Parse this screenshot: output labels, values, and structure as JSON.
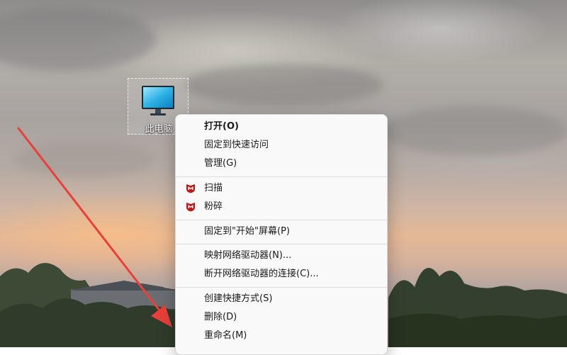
{
  "desktop": {
    "icon_label": "此电脑"
  },
  "context_menu": {
    "items": [
      {
        "label": "打开(O)",
        "bold": true
      },
      {
        "label": "固定到快速访问"
      },
      {
        "label": "管理(G)"
      },
      {
        "label": "扫描",
        "icon": "mcafee-shield-icon"
      },
      {
        "label": "粉碎",
        "icon": "mcafee-shield-icon"
      },
      {
        "label": "固定到\"开始\"屏幕(P)"
      },
      {
        "label": "映射网络驱动器(N)..."
      },
      {
        "label": "断开网络驱动器的连接(C)..."
      },
      {
        "label": "创建快捷方式(S)"
      },
      {
        "label": "删除(D)"
      },
      {
        "label": "重命名(M)"
      }
    ]
  },
  "colors": {
    "annotation_arrow": "#e8403a",
    "mcafee_red": "#c01818",
    "menu_bg": "#f9f9f9"
  }
}
